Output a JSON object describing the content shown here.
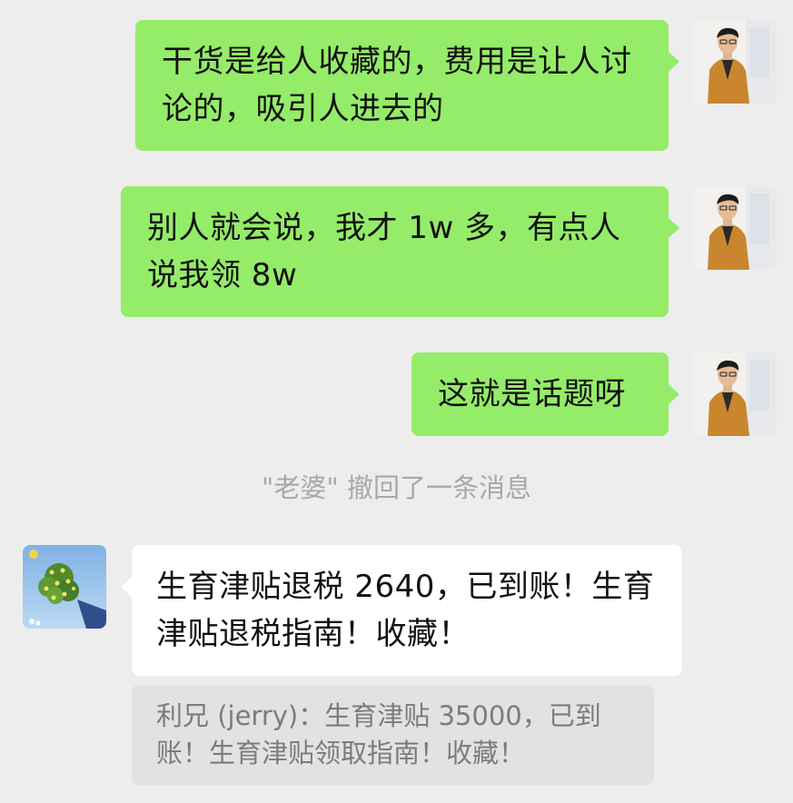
{
  "chat": {
    "messages": [
      {
        "sender": "self",
        "text": "干货是给人收藏的，费用是让人讨论的，吸引人进去的"
      },
      {
        "sender": "self",
        "text": "别人就会说，我才 1w 多，有点人说我领 8w"
      },
      {
        "sender": "self",
        "text": "这就是话题呀"
      },
      {
        "sender": "other",
        "text": "生育津贴退税 2640，已到账！生育津贴退税指南！收藏！"
      }
    ],
    "recall_notice": "\"老婆\" 撤回了一条消息",
    "quote": "利兄 (jerry)：生育津贴 35000，已到账！生育津贴领取指南！收藏！"
  },
  "colors": {
    "background": "#ededed",
    "outgoing_bubble": "#95ec69",
    "incoming_bubble": "#ffffff",
    "quote_background": "#e2e2e2",
    "system_text": "#a8a8a8"
  },
  "icons": {
    "self_avatar": "avatar-man-orange-coat",
    "other_avatar": "avatar-flower-bouquet"
  }
}
